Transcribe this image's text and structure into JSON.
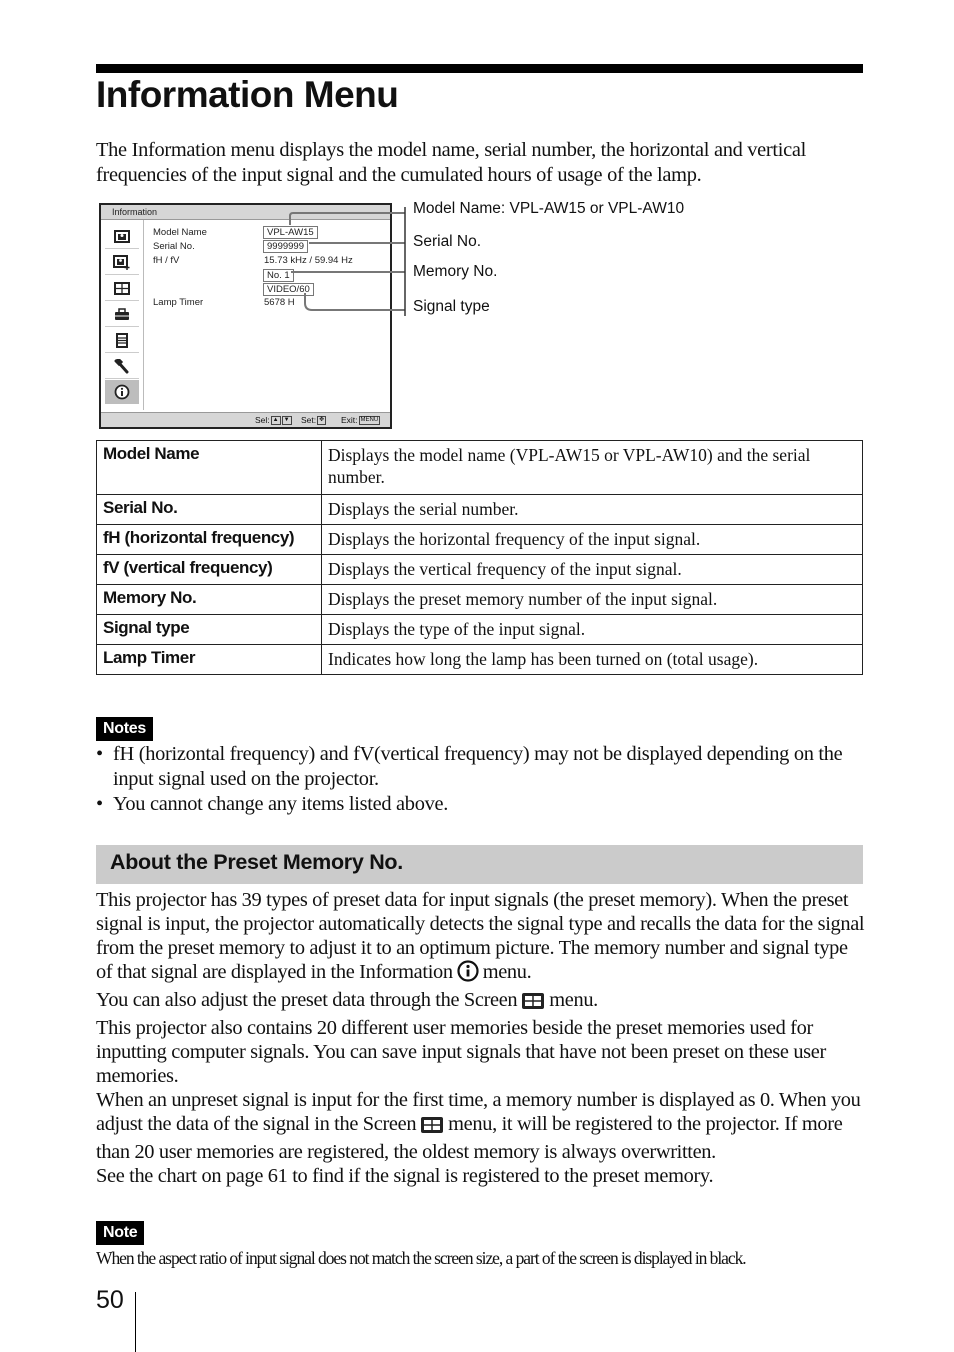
{
  "page": {
    "title": "Information Menu",
    "intro": "The Information menu displays the model name, serial number, the horizontal and vertical frequencies of the input signal and the cumulated hours of usage of the lamp.",
    "page_number": "50"
  },
  "osd": {
    "header": "Information",
    "sidebar_icons": [
      "picture-icon",
      "advanced-picture-icon",
      "screen-icon",
      "setup-icon",
      "menu-setting-icon",
      "installation-icon",
      "information-icon"
    ],
    "active_icon": "information-icon",
    "rows": [
      {
        "label": "Model Name",
        "value": "VPL-AW15"
      },
      {
        "label": "Serial No.",
        "value": "9999999"
      },
      {
        "label": "fH / fV",
        "value": "15.73 kHz / 59.94 Hz"
      },
      {
        "label": "",
        "value": "No. 1"
      },
      {
        "label": "",
        "value": "VIDEO/60"
      },
      {
        "label": "Lamp Timer",
        "value": "5678 H"
      }
    ],
    "footer": {
      "sel": "Sel:",
      "set": "Set:",
      "exit": "Exit:",
      "exit_key": "MENU"
    }
  },
  "callouts": [
    "Model Name: VPL-AW15 or VPL-AW10",
    "Serial No.",
    "Memory No.",
    "Signal type"
  ],
  "table": [
    {
      "item": "Model Name",
      "description": "Displays the model name (VPL-AW15 or VPL-AW10) and the serial number."
    },
    {
      "item": "Serial No.",
      "description": "Displays the serial number."
    },
    {
      "item": "fH (horizontal frequency)",
      "description": "Displays the horizontal frequency of the input signal."
    },
    {
      "item": "fV (vertical frequency)",
      "description": "Displays the vertical frequency of the input signal."
    },
    {
      "item": "Memory No.",
      "description": "Displays the preset memory number of the input signal."
    },
    {
      "item": "Signal type",
      "description": "Displays the type of the input signal."
    },
    {
      "item": "Lamp Timer",
      "description": "Indicates how long the lamp has been turned on (total usage)."
    }
  ],
  "notes": {
    "label": "Notes",
    "items": [
      "fH (horizontal frequency) and fV(vertical frequency) may not be displayed depending on the input signal used on the projector.",
      "You cannot change any items listed above."
    ]
  },
  "section": {
    "title": "About the Preset Memory No.",
    "p1a": "This projector has 39 types of preset data for input signals (the preset memory). When the preset signal is input, the projector automatically detects the signal type and recalls the data for the signal from the preset memory to adjust it to an optimum picture. The memory number and signal type of that signal are displayed in the Information",
    "p1b": "menu.",
    "p2a": "You can also adjust the preset data through the Screen",
    "p2b": "menu.",
    "p3": "This projector also contains 20 different user memories beside the preset memories used for inputting computer signals. You can save input signals that have not been preset on these user memories.",
    "p4a": "When an unpreset signal is input for the first time, a memory number is displayed as 0. When you adjust the data of the signal in the Screen",
    "p4b": "menu, it will be registered to the projector. If more than 20 user memories are registered, the oldest memory is always overwritten.",
    "p5": "See the chart on page 61 to find if the signal is registered to the preset memory."
  },
  "note": {
    "label": "Note",
    "text": "When the aspect ratio of input signal does not match the screen size, a part of the screen is displayed in black."
  }
}
